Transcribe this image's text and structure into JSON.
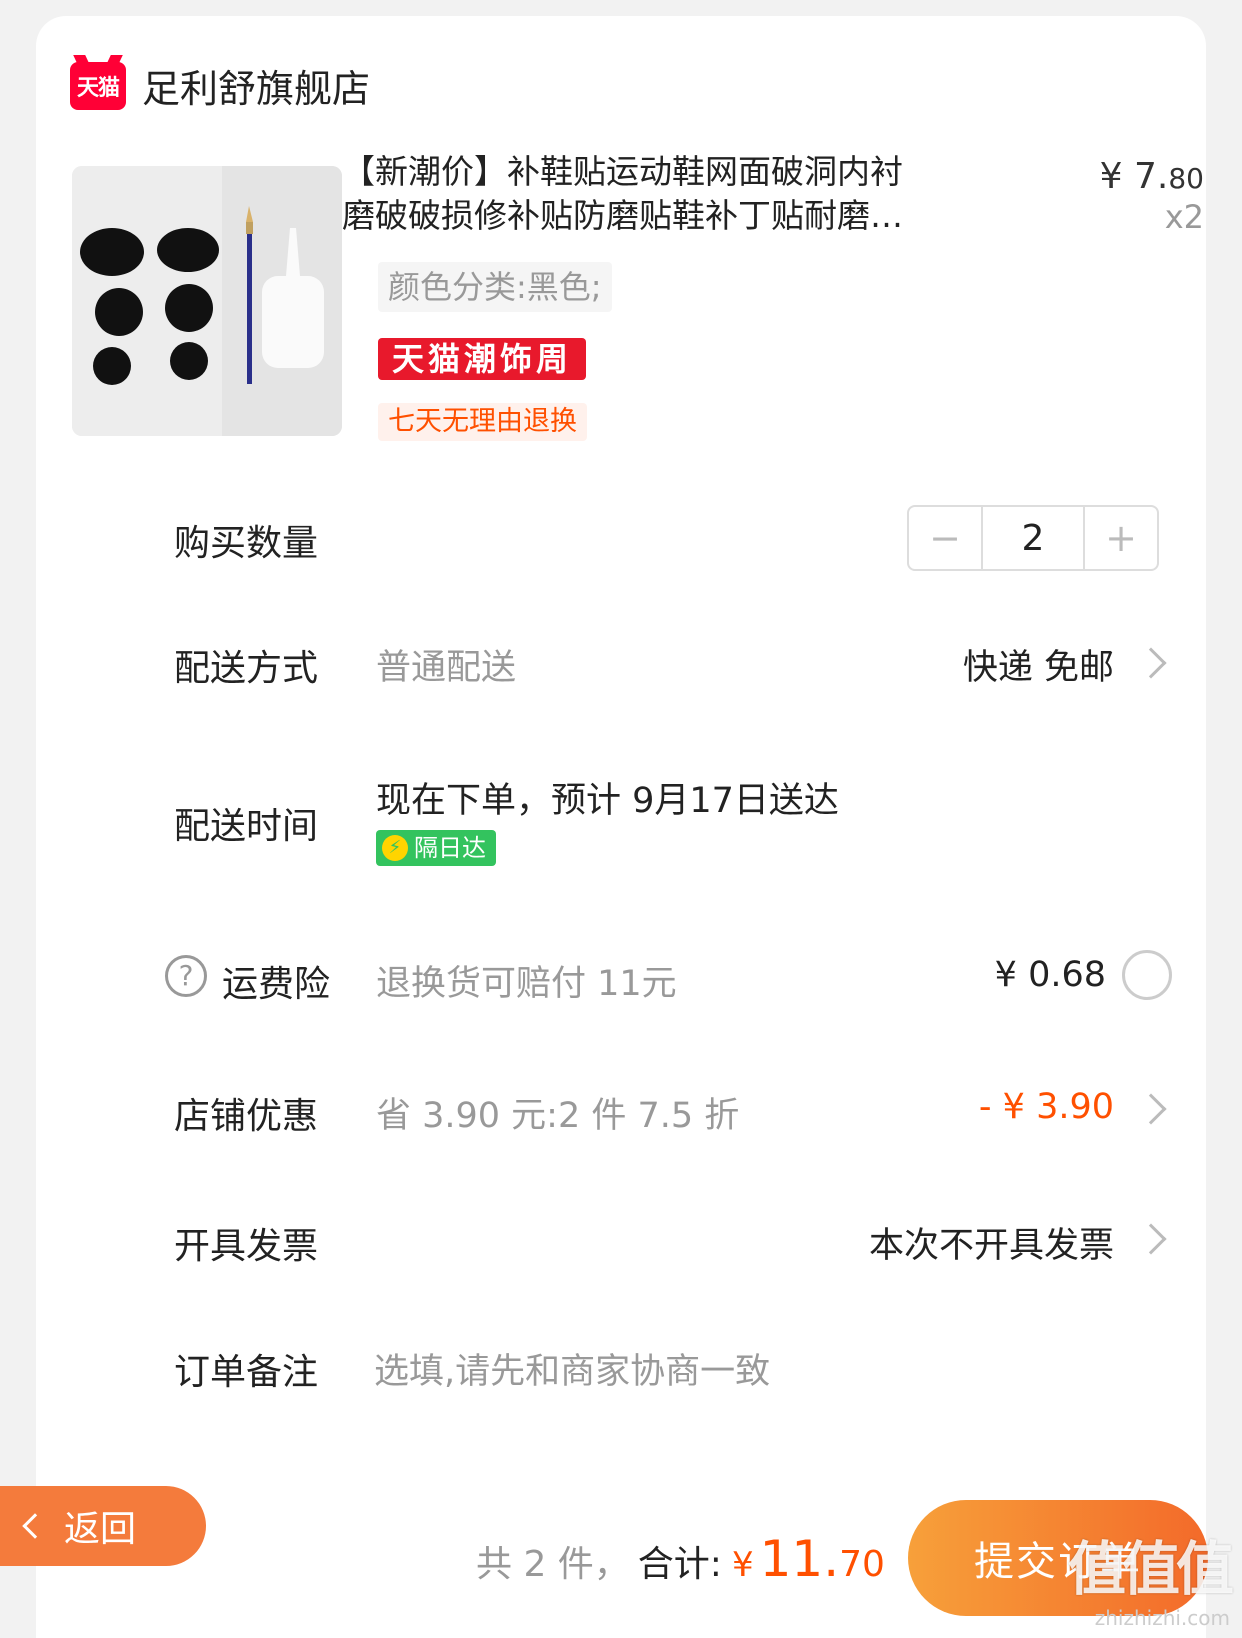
{
  "shop": {
    "badge": "天猫",
    "name": "足利舒旗舰店"
  },
  "product": {
    "title_line1": "【新潮价】补鞋贴运动鞋网面破洞内衬",
    "title_line2": "磨破破损修补贴防磨贴鞋补丁贴耐磨…",
    "price_yen": "¥ 7.",
    "price_cents": "80",
    "quantity_label": "x2",
    "spec": "颜色分类:黑色;",
    "promo_tag": "天猫潮饰周",
    "return_tag": "七天无理由退换"
  },
  "rows": {
    "quantity": {
      "label": "购买数量",
      "minus": "−",
      "value": "2",
      "plus": "+"
    },
    "delivery_method": {
      "label": "配送方式",
      "sub": "普通配送",
      "value": "快递 免邮"
    },
    "delivery_time": {
      "label": "配送时间",
      "value": "现在下单，预计 9月17日送达",
      "badge": "隔日达",
      "badge_icon": "⚡"
    },
    "insurance": {
      "label": "运费险",
      "help": "?",
      "sub": "退换货可赔付 11元",
      "value": "¥ 0.68"
    },
    "shop_discount": {
      "label": "店铺优惠",
      "sub": "省 3.90 元:2 件 7.5 折",
      "value": "- ¥ 3.90"
    },
    "invoice": {
      "label": "开具发票",
      "value": "本次不开具发票"
    },
    "note": {
      "label": "订单备注",
      "placeholder": "选填,请先和商家协商一致"
    }
  },
  "footer": {
    "back_label": "返回",
    "count_text": "共 2 件，",
    "total_label": "合计:",
    "total_yen": "¥",
    "total_int": "11.",
    "total_dec": "70",
    "submit_label": "提交订单"
  },
  "watermark": {
    "main": "值值值",
    "url": "zhizhizhi.com"
  },
  "colors": {
    "accent": "#ff5000",
    "tmall_red": "#ff0036",
    "submit_start": "#f7a03a",
    "submit_end": "#f36a2a",
    "next_day_green": "#33c35e"
  }
}
